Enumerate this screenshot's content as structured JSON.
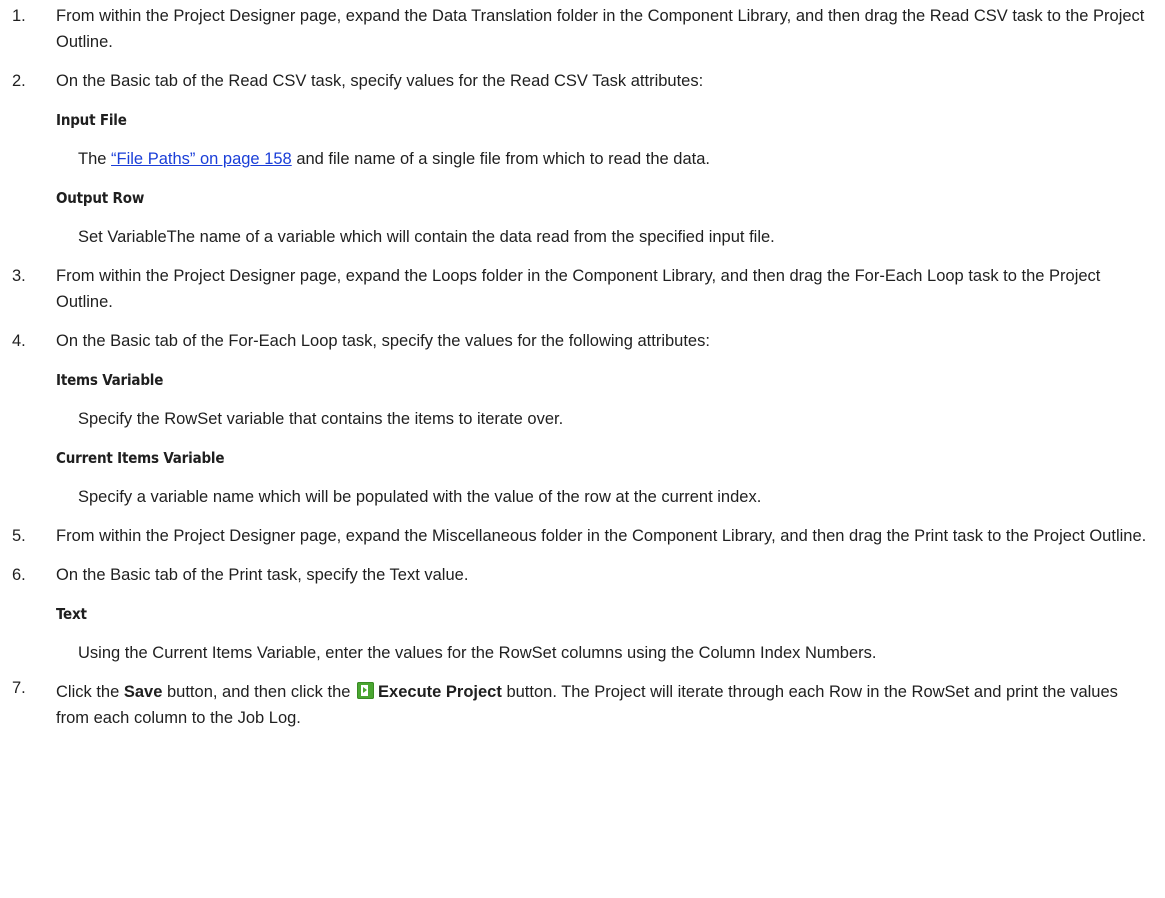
{
  "steps": [
    {
      "num": "1.",
      "text": "From within the Project Designer page, expand the Data Translation folder in the Component Library, and then drag the Read CSV task to the Project Outline."
    },
    {
      "num": "2.",
      "text": "On the Basic tab of the Read CSV task, specify values for the Read CSV Task attributes:",
      "attrs": [
        {
          "title": "Input File",
          "desc_before": "The ",
          "link": "“File Paths” on page 158",
          "desc_after": " and file name of a single file from which to read the data."
        },
        {
          "title": "Output Row",
          "desc": "Set VariableThe name of a variable which will contain the data read from the specified input file."
        }
      ]
    },
    {
      "num": "3.",
      "text": "From within the Project Designer page, expand the Loops folder in the Component Library, and then drag the For-Each Loop task to the Project Outline."
    },
    {
      "num": "4.",
      "text": "On the Basic tab of the For-Each Loop task, specify the values for the following attributes:",
      "attrs": [
        {
          "title": "Items Variable",
          "desc": "Specify the RowSet variable that contains the items to iterate over."
        },
        {
          "title": "Current Items Variable",
          "desc": "Specify a variable name which will be populated with the value of the row at the current index."
        }
      ]
    },
    {
      "num": "5.",
      "text": "From within the Project Designer page, expand the Miscellaneous folder in the Component Library, and then drag the Print task to the Project Outline."
    },
    {
      "num": "6.",
      "text": "On the Basic tab of the Print task, specify the Text value.",
      "attrs": [
        {
          "title": "Text",
          "desc": "Using the Current Items Variable, enter the values for the RowSet columns using the Column Index Numbers."
        }
      ]
    },
    {
      "num": "7.",
      "part1": "Click the ",
      "save_label": "Save",
      "part2": " button, and then click the ",
      "icon": "execute-project-icon",
      "execute_label": "Execute Project",
      "part3": " button. The Project will iterate through each Row in the RowSet and print the values from each column to the Job Log."
    }
  ],
  "colors": {
    "link": "#1a3ed8",
    "icon_green": "#4aa631",
    "text": "#1f1f1f"
  }
}
